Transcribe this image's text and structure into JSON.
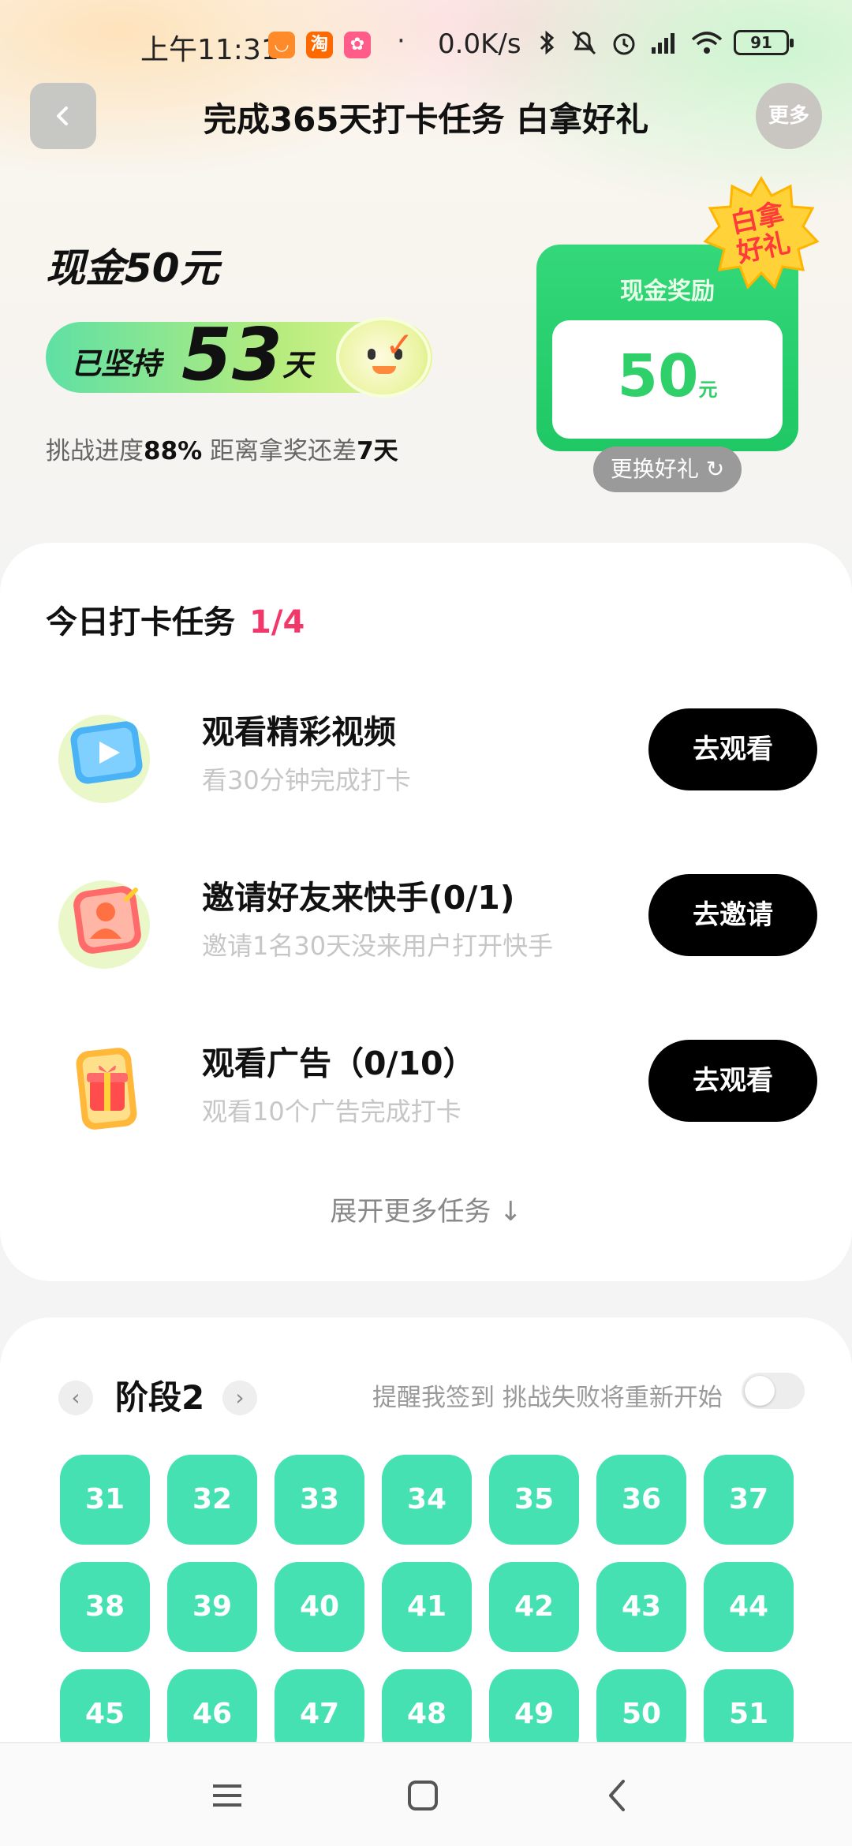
{
  "status_bar": {
    "time": "上午11:31",
    "app_icons": [
      "taobao-badge",
      "tao",
      "pink-app"
    ],
    "tao_text": "淘",
    "dot": "·",
    "speed": "0.0K/s",
    "battery": "91"
  },
  "header": {
    "title": "完成365天打卡任务 白拿好礼",
    "more_label": "更多"
  },
  "hero": {
    "cash_title": "现金50元",
    "persist_label": "已坚持",
    "persist_days": "53",
    "persist_unit": "天",
    "progress_prefix": "挑战进度",
    "progress_percent": "88%",
    "progress_mid": " 距离拿奖还差",
    "remaining_days": "7天",
    "reward": {
      "header": "现金奖励",
      "amount": "50",
      "unit": "元",
      "badge": "白拿好礼",
      "swap_label": "更换好礼 ↻"
    }
  },
  "tasks": {
    "heading": "今日打卡任务",
    "count": "1/4",
    "items": [
      {
        "title": "观看精彩视频",
        "subtitle": "看30分钟完成打卡",
        "button": "去观看",
        "icon": "video-play-icon"
      },
      {
        "title": "邀请好友来快手(0/1)",
        "subtitle": "邀请1名30天没来用户打开快手",
        "button": "去邀请",
        "icon": "invite-friend-icon"
      },
      {
        "title": "观看广告（0/10）",
        "subtitle": "观看10个广告完成打卡",
        "button": "去观看",
        "icon": "gift-ad-icon"
      }
    ],
    "expand_label": "展开更多任务 ↓"
  },
  "stage": {
    "prev": "‹",
    "title": "阶段2",
    "next": "›",
    "remind_text": "提醒我签到 挑战失败将重新开始",
    "remind_enabled": false,
    "days": [
      "31",
      "32",
      "33",
      "34",
      "35",
      "36",
      "37",
      "38",
      "39",
      "40",
      "41",
      "42",
      "43",
      "44",
      "45",
      "46",
      "47",
      "48",
      "49",
      "50",
      "51"
    ]
  },
  "colors": {
    "accent_green": "#45e1b2",
    "reward_green": "#1fc864",
    "count_pink": "#f2386a",
    "button_black": "#000000"
  }
}
